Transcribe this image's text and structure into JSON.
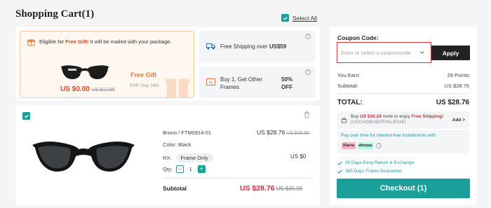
{
  "page": {
    "title": "Shopping Cart(1)"
  },
  "select_all": {
    "label": "Select All",
    "checked": true
  },
  "promos": {
    "gift": {
      "text_pre": "Eligible for ",
      "text_highlight": "Free Gift!",
      "text_post": " It will be mailed with your package.",
      "price": "US $0.00",
      "old_price": "US $12.95",
      "tag": "Free Gift",
      "expiry": "EXP. Sep 26th",
      "product_icon": "sunglasses-icon"
    },
    "shipping": {
      "text": "Free Shipping over ",
      "amount": "US$59",
      "icon": "truck-icon"
    },
    "bogo": {
      "text": "Buy 1, Get Other Frames",
      "discount": "50% OFF",
      "icon": "percent-tag-icon"
    }
  },
  "product": {
    "checked": true,
    "name": "Bruno / FTM0914-01",
    "price": "US $28.76",
    "old_price": "US $35.95",
    "color_label": "Color: Black",
    "rx_label": "RX:",
    "rx_value": "Frame Only",
    "rx_price": "US $0",
    "qty_label": "Qty:",
    "qty": "1",
    "qty_minus": "−",
    "qty_plus": "+",
    "subtotal_label": "Subtotal",
    "subtotal": "US $28.76",
    "subtotal_old": "US $35.95"
  },
  "summary": {
    "coupon_label": "Coupon Code:",
    "coupon_placeholder": "Enter or select a coupon/code",
    "apply_label": "Apply",
    "earn_label": "You Earn:",
    "earn_value": "29 Points",
    "subtotal_label": "Subtotal:",
    "subtotal_value": "US $28.76",
    "total_label": "TOTAL:",
    "total_value": "US $28.76",
    "ship_promo_pre": "Buy ",
    "ship_promo_amount": "US $30.24",
    "ship_promo_mid": " more to enjoy ",
    "ship_promo_highlight": "Free Shipping!",
    "ship_promo_regions": "(US/CA/GB/DE/FR/NL/ES/IE)",
    "ship_promo_add": "Add >",
    "installments_text": "Pay over time for interest-free installments with",
    "klarna": "Klarna",
    "afterpay": "afterpay",
    "perk1": "30 Days Easy Return & Exchange",
    "perk2": "365 Days Frame Guarantee",
    "checkout_label": "Checkout (1)"
  },
  "colors": {
    "accent": "#1a9f9a",
    "sale_red": "#e5263b",
    "gift_orange": "#f07b2a"
  }
}
